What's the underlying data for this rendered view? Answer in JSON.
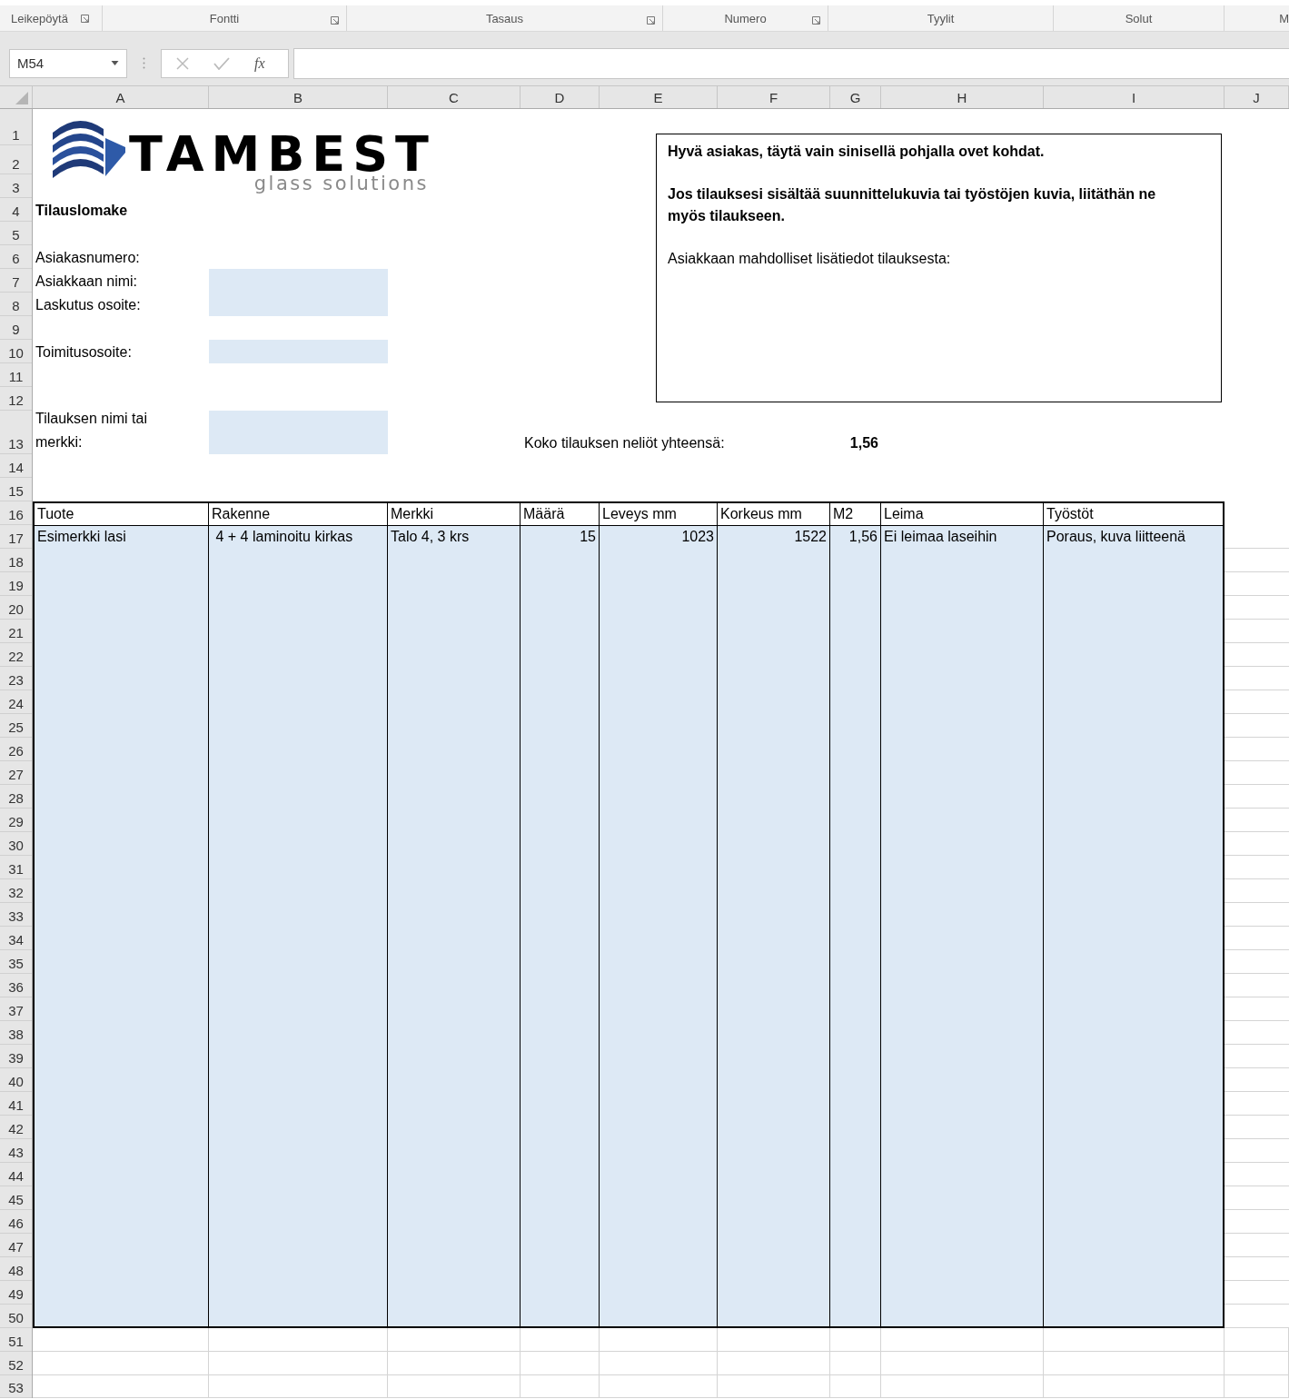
{
  "ribbon_groups": [
    {
      "label": "Leikepöytä",
      "launcher": true
    },
    {
      "label": "Fontti",
      "launcher": true
    },
    {
      "label": "Tasaus",
      "launcher": true
    },
    {
      "label": "Numero",
      "launcher": true
    },
    {
      "label": "Tyylit",
      "launcher": false
    },
    {
      "label": "Solut",
      "launcher": false
    },
    {
      "label": "M",
      "launcher": false
    }
  ],
  "formula_bar": {
    "name_box": "M54",
    "function_button": "fx"
  },
  "sheet": {
    "columns": [
      "A",
      "B",
      "C",
      "D",
      "E",
      "F",
      "G",
      "H",
      "I",
      "J"
    ],
    "row_numbers": [
      "1",
      "2",
      "3",
      "4",
      "5",
      "6",
      "7",
      "8",
      "9",
      "10",
      "11",
      "12",
      "13",
      "14",
      "15",
      "16",
      "17",
      "18",
      "19",
      "20",
      "21",
      "22",
      "23",
      "24",
      "25",
      "26",
      "27",
      "28",
      "29",
      "30",
      "31",
      "32",
      "33",
      "34",
      "35",
      "36",
      "37",
      "38",
      "39",
      "40",
      "41",
      "42",
      "43",
      "44",
      "45",
      "46",
      "47",
      "48",
      "49",
      "50",
      "51",
      "52",
      "53"
    ]
  },
  "logo": {
    "wordmark": "TAMBEST",
    "tagline": "glass solutions"
  },
  "title": "Tilauslomake",
  "form_labels": [
    "Asiakasnumero:",
    "Asiakkaan nimi:",
    "Laskutus osoite:",
    "Toimitusosoite:",
    "Tilauksen nimi tai merkki:"
  ],
  "info_box": [
    {
      "text": "Hyvä asiakas, täytä vain sinisellä pohjalla ovet kohdat.",
      "bold": true
    },
    {
      "text": "Jos tilauksesi sisältää suunnittelukuvia tai työstöjen kuvia, liitäthän ne myös tilaukseen.",
      "bold": true
    },
    {
      "text": "Asiakkaan mahdolliset lisätiedot tilauksesta:",
      "bold": false
    }
  ],
  "total": {
    "label": "Koko tilauksen neliöt yhteensä:",
    "value": "1,56"
  },
  "table": {
    "columns": [
      {
        "label": "Tuote",
        "numeric": false
      },
      {
        "label": "Rakenne",
        "numeric": false
      },
      {
        "label": "Merkki",
        "numeric": false
      },
      {
        "label": "Määrä",
        "numeric": true
      },
      {
        "label": "Leveys mm",
        "numeric": true
      },
      {
        "label": "Korkeus mm",
        "numeric": true
      },
      {
        "label": "M2",
        "numeric": true
      },
      {
        "label": "Leima",
        "numeric": false
      },
      {
        "label": "Työstöt",
        "numeric": false
      }
    ],
    "rows": [
      [
        "Esimerkki lasi",
        " 4 + 4 laminoitu kirkas",
        "Talo 4, 3 krs",
        "15",
        "1023",
        "1522",
        "1,56",
        "Ei leimaa laseihin",
        "Poraus, kuva liitteenä"
      ]
    ]
  }
}
